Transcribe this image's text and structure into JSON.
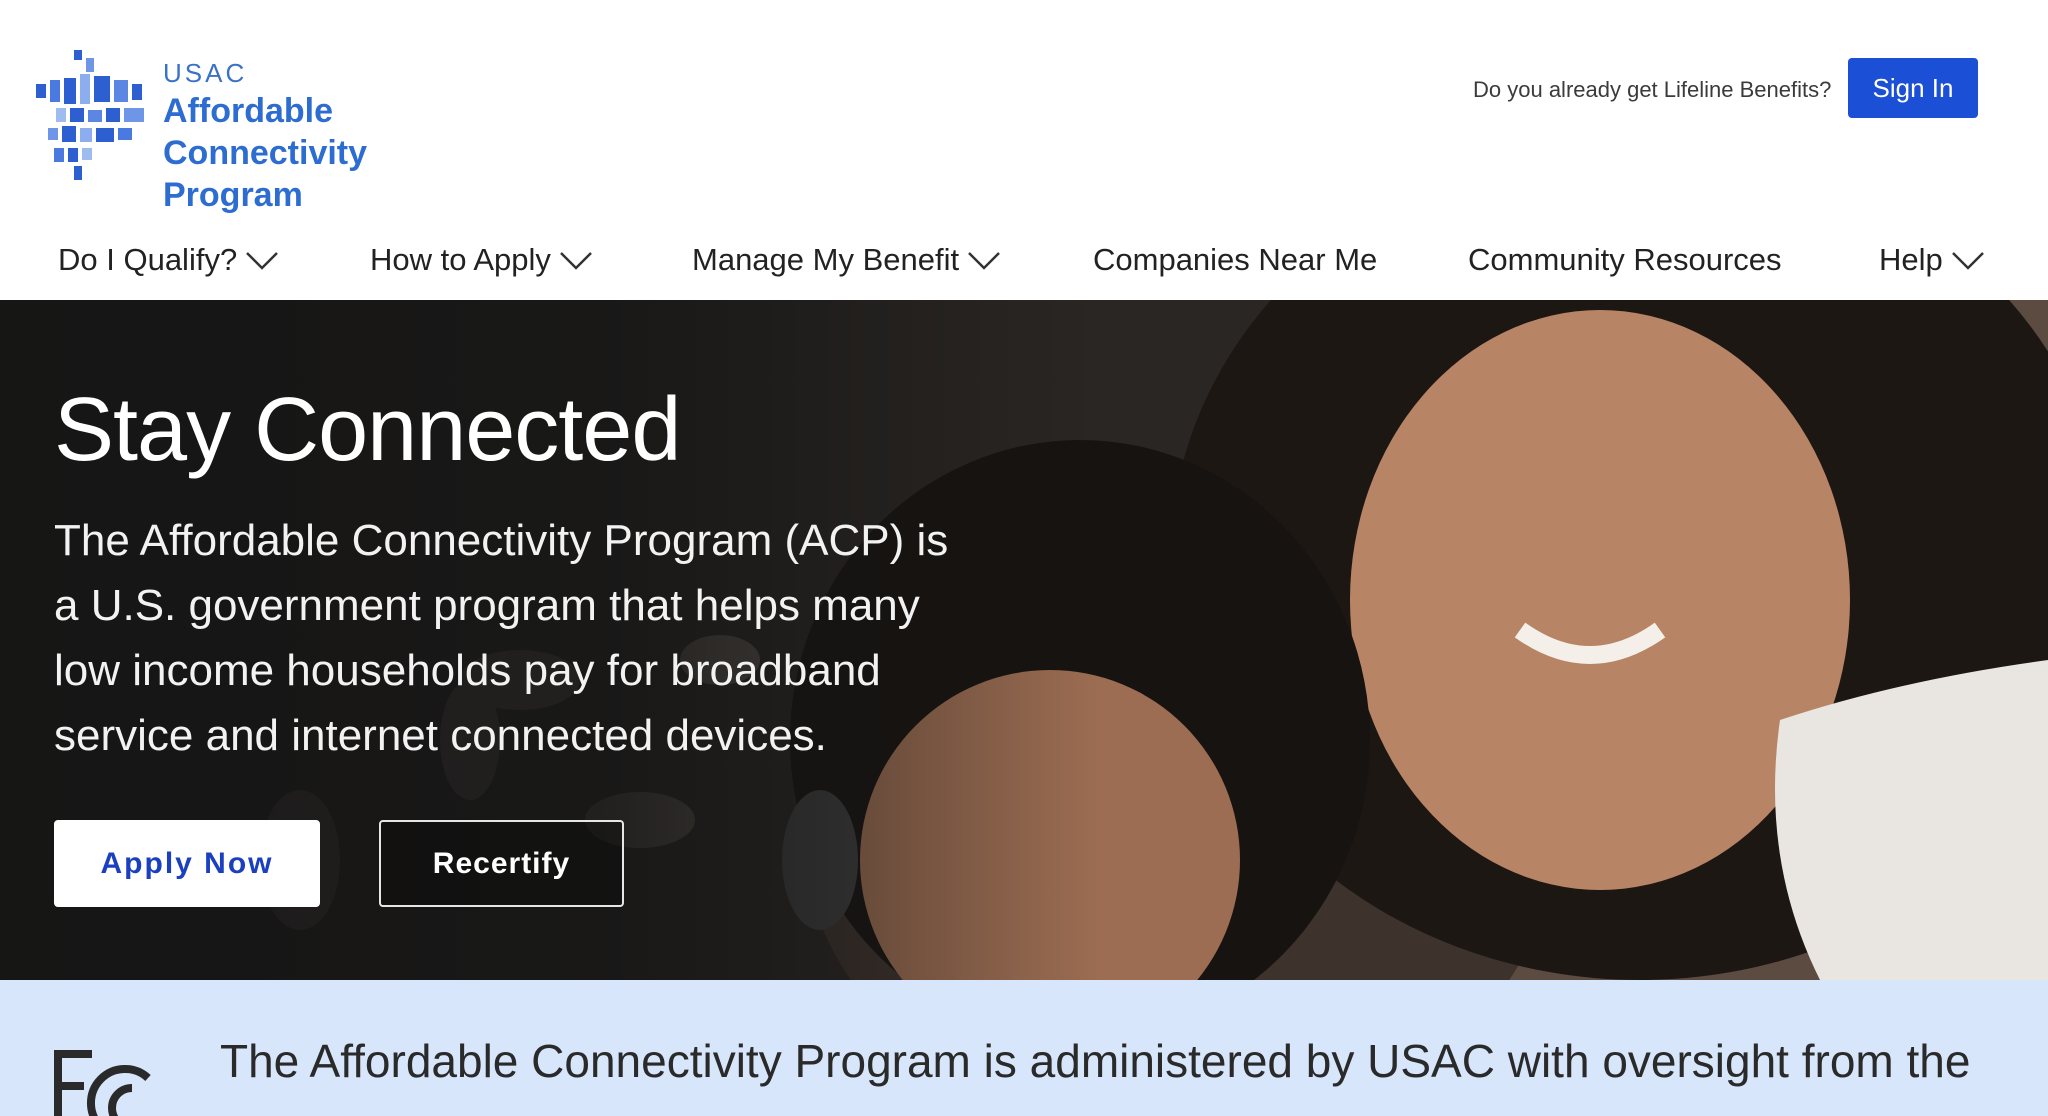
{
  "header": {
    "logo": {
      "org": "USAC",
      "line1": "Affordable",
      "line2": "Connectivity Program"
    },
    "lifeline_question": "Do you already get Lifeline Benefits?",
    "signin_label": "Sign In"
  },
  "nav": {
    "items": [
      {
        "label": "Do I Qualify?",
        "has_dropdown": true
      },
      {
        "label": "How to Apply",
        "has_dropdown": true
      },
      {
        "label": "Manage My Benefit",
        "has_dropdown": true
      },
      {
        "label": "Companies Near Me",
        "has_dropdown": false
      },
      {
        "label": "Community Resources",
        "has_dropdown": false
      },
      {
        "label": "Help",
        "has_dropdown": true
      }
    ]
  },
  "hero": {
    "title": "Stay Connected",
    "description": "The Affordable Connectivity Program (ACP) is a U.S. government program that helps many low income households pay for broadband service and internet connected devices.",
    "apply_label": "Apply Now",
    "recertify_label": "Recertify"
  },
  "band": {
    "text": "The Affordable Connectivity Program is administered by USAC with oversight from the"
  },
  "colors": {
    "brand_blue": "#1a4fd6",
    "logo_blue": "#2d6cd1",
    "band_bg": "#d7e6fb",
    "hero_dark": "#1b1b1b"
  }
}
